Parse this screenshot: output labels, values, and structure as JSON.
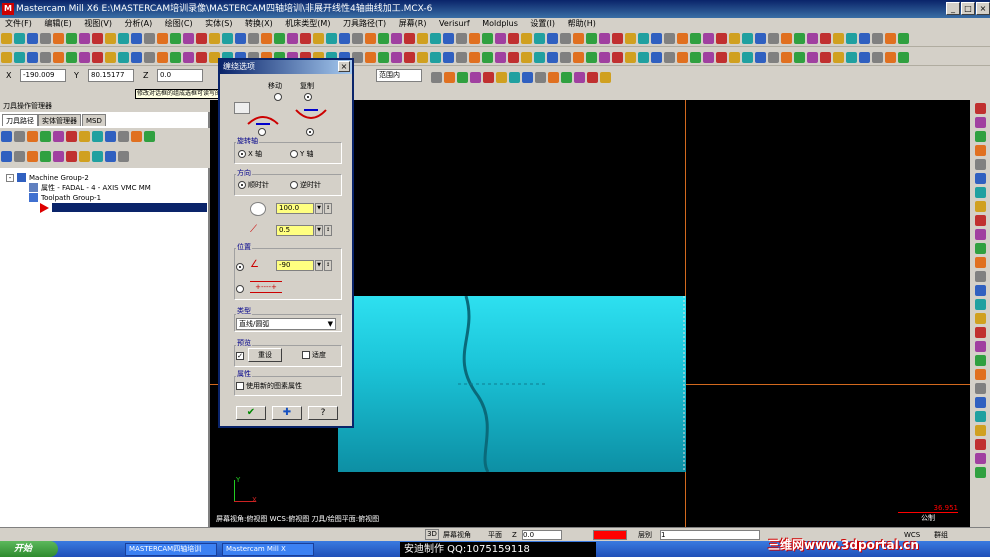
{
  "window": {
    "title": "Mastercam Mill X6   E:\\MASTERCAM培训录像\\MASTERCAM四轴培训\\非展开线性4轴曲线加工.MCX-6",
    "min_label": "_",
    "max_label": "□",
    "close_label": "×"
  },
  "menu": [
    "文件(F)",
    "编辑(E)",
    "视图(V)",
    "分析(A)",
    "绘图(C)",
    "实体(S)",
    "转换(X)",
    "机床类型(M)",
    "刀具路径(T)",
    "屏幕(R)",
    "Verisurf",
    "Moldplus",
    "设置(I)",
    "帮助(H)"
  ],
  "ribbon": {
    "x_label": "X",
    "x_value": "-190.009",
    "y_label": "Y",
    "y_value": "80.15177",
    "z_label": "Z",
    "z_value": "0.0",
    "range_label": "范围内"
  },
  "tooltip": "修改对话框的组成选框可读写的模板.",
  "left_panel": {
    "title": "刀具操作管理器",
    "tabs": [
      "刀具路径",
      "实体管理器",
      "MSD"
    ],
    "tree": [
      "Machine Group-2",
      "属性 - FADAL - 4 - AXIS VMC MM",
      "Toolpath Group-1"
    ]
  },
  "dialog": {
    "title": "缠绕选项",
    "move_label": "移动",
    "copy_label": "复制",
    "axis_group": "旋转轴",
    "axis_x": "X 轴",
    "axis_y": "Y 轴",
    "direction_group": "方向",
    "dir_cw": "顺时针",
    "dir_ccw": "逆时针",
    "diameter_value": "100.0",
    "tolerance_value": "0.5",
    "position_group": "位置",
    "angle_value": "-90",
    "type_group": "类型",
    "type_value": "直线/圆弧",
    "preview_group": "预览",
    "reset_label": "重设",
    "fit_label": "适度",
    "attr_group": "属性",
    "attr_check": "使用新的图素属性"
  },
  "viewport": {
    "status": "屏幕视角:俯视图    WCS:俯视图    刀具/绘图平面:俯视图",
    "scale_value": "36.951",
    "scale_unit": "公制",
    "axis_y": "Y",
    "axis_x": "X"
  },
  "statusbar": {
    "value_3d": "3D",
    "view_label": "屏幕视角",
    "plane_label": "平面",
    "z_label": "Z",
    "z_value": "0.0",
    "level_label": "层别",
    "level_value": "1",
    "wcs_label": "WCS",
    "group_label": "群组"
  },
  "taskbar": {
    "start": "开始",
    "tasks": [
      "MASTERCAM四轴培训",
      "Mastercam Mill X"
    ]
  },
  "overlay": "安迪制作      QQ:1075159118",
  "watermark": "三维网www.3dportal.cn",
  "colors": {
    "cyan": "#1bc4d8",
    "viewport_bg": "#000000",
    "axis_line": "#d2691e",
    "field_yellow": "#ffff80"
  }
}
